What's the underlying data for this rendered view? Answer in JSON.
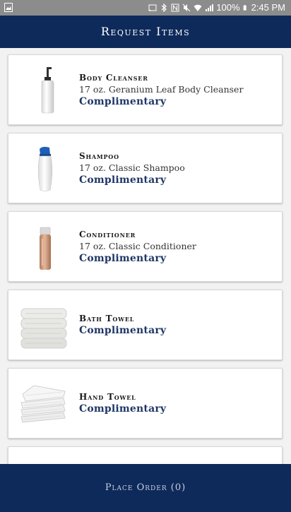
{
  "status_bar": {
    "battery": "100%",
    "time": "2:45 PM",
    "icons": [
      "image-icon",
      "cast-icon",
      "bluetooth-icon",
      "nfc-icon",
      "mute-icon",
      "wifi-icon",
      "signal-icon",
      "battery-icon"
    ]
  },
  "header": {
    "title": "Request Items"
  },
  "items": [
    {
      "name": "Body Cleanser",
      "description": "17 oz. Geranium Leaf Body Cleanser",
      "price": "Complimentary",
      "icon": "pump-bottle-icon"
    },
    {
      "name": "Shampoo",
      "description": "17 oz. Classic Shampoo",
      "price": "Complimentary",
      "icon": "shampoo-bottle-icon"
    },
    {
      "name": "Conditioner",
      "description": "17 oz. Classic Conditioner",
      "price": "Complimentary",
      "icon": "conditioner-bottle-icon"
    },
    {
      "name": "Bath Towel",
      "description": "",
      "price": "Complimentary",
      "icon": "bath-towel-icon"
    },
    {
      "name": "Hand Towel",
      "description": "",
      "price": "Complimentary",
      "icon": "hand-towel-icon"
    }
  ],
  "footer": {
    "place_order_label": "Place Order (0)"
  },
  "colors": {
    "navy": "#0e2a5b",
    "price_text": "#1f3766",
    "status_bar": "#8c8c8c"
  }
}
